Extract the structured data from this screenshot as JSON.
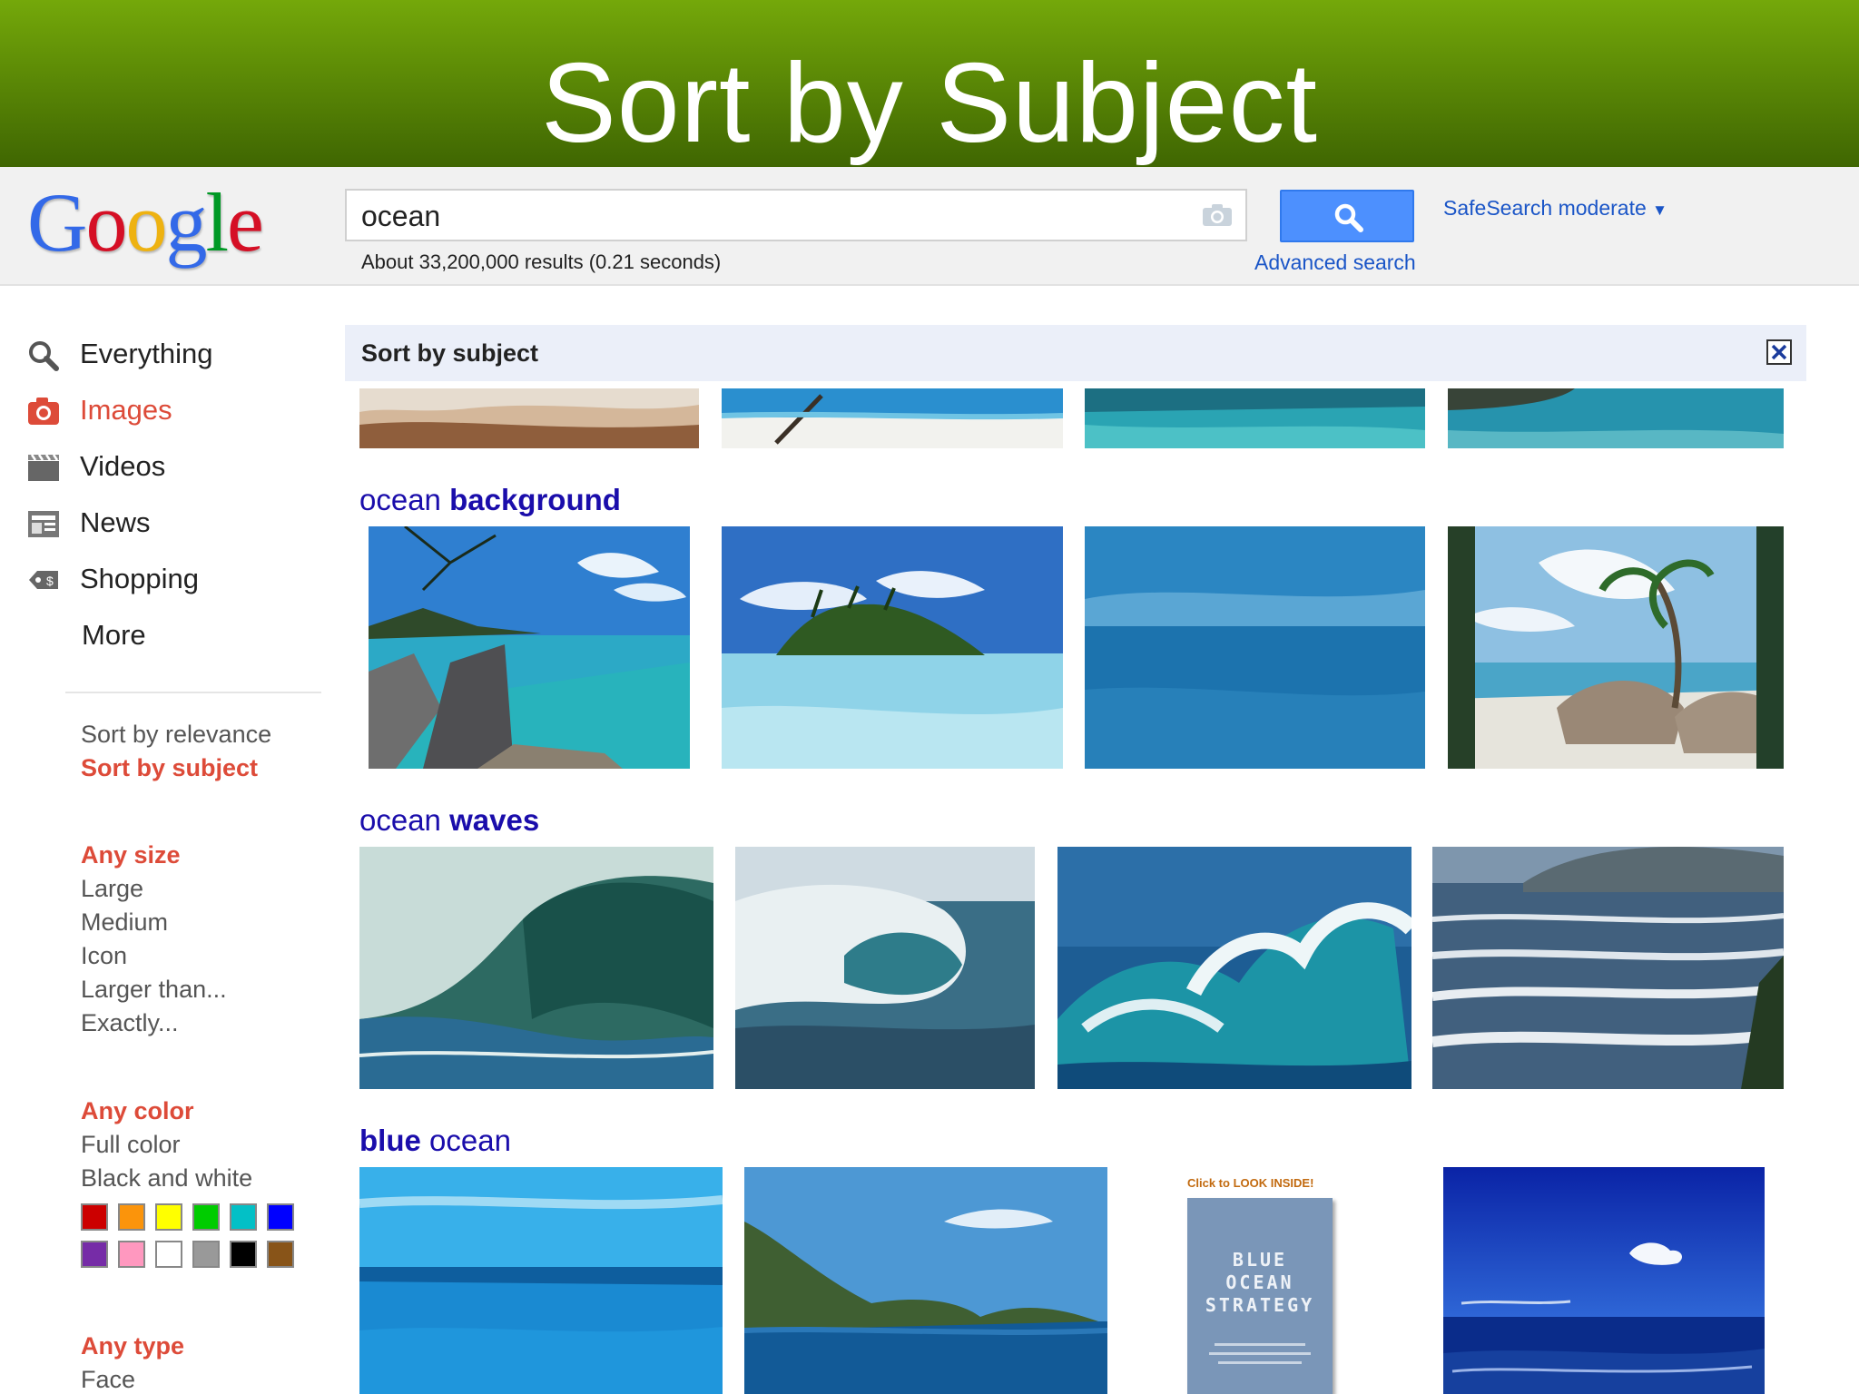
{
  "slide": {
    "title": "Sort by Subject"
  },
  "header": {
    "logo_text": "Google",
    "search_value": "ocean",
    "search_button_icon": "search-icon",
    "safesearch_label": "SafeSearch moderate",
    "results_stats": "About 33,200,000 results (0.21 seconds)",
    "advanced_search_label": "Advanced search"
  },
  "sidebar": {
    "nav": [
      {
        "label": "Everything",
        "icon": "search-icon"
      },
      {
        "label": "Images",
        "icon": "camera-icon",
        "active": true
      },
      {
        "label": "Videos",
        "icon": "film-icon"
      },
      {
        "label": "News",
        "icon": "newspaper-icon"
      },
      {
        "label": "Shopping",
        "icon": "price-tag-icon"
      },
      {
        "label": "More"
      }
    ],
    "sort": {
      "relevance": "Sort by relevance",
      "subject": "Sort by subject"
    },
    "size": {
      "heading": "Any size",
      "options": [
        "Large",
        "Medium",
        "Icon",
        "Larger than...",
        "Exactly..."
      ]
    },
    "color": {
      "heading": "Any color",
      "options": [
        "Full color",
        "Black and white"
      ],
      "swatches": [
        "#cc0000",
        "#fb940b",
        "#ffff00",
        "#00cc00",
        "#03c0c6",
        "#0000ff",
        "#762ca7",
        "#ff98bf",
        "#ffffff",
        "#999999",
        "#000000",
        "#885418"
      ]
    },
    "type": {
      "heading": "Any type",
      "options": [
        "Face"
      ]
    }
  },
  "panel": {
    "title": "Sort by subject",
    "close_icon": "close-icon"
  },
  "groups": [
    {
      "prefix": "ocean",
      "suffix": "background"
    },
    {
      "prefix": "ocean",
      "suffix": "waves"
    },
    {
      "prefix": "blue",
      "suffix": "ocean"
    }
  ],
  "book_cover": {
    "banner": "Click to LOOK INSIDE!",
    "title_lines": [
      "BLUE",
      "OCEAN",
      "STRATEGY"
    ]
  },
  "colors": {
    "accent_red": "#dd4b39",
    "link_blue": "#1a0dab",
    "button_blue": "#4d90fe",
    "banner_green": "#5c8a06"
  }
}
